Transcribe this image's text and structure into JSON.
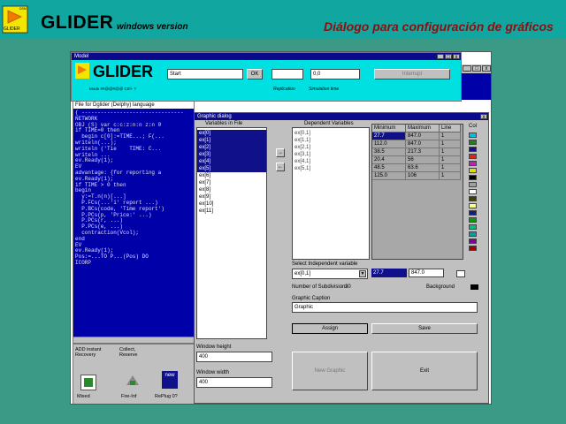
{
  "banner": {
    "title": "GLIDER",
    "version": "windows version",
    "subtitle": "Diálogo para configuración de gráficos",
    "logo_text_top": "DSM",
    "logo_text_bottom": "GLIDER"
  },
  "model_window": {
    "title": "Model",
    "app_name": "GLIDER",
    "input_start": "Start",
    "ok_label": "OK",
    "field_2": "",
    "field_3": "0,0",
    "interrupt_label": "Interrupt",
    "replication_label": "Replication",
    "simulation_time_label": "Simulation time",
    "small_text": "Mode ##@@#@@ Ctrl+ ?"
  },
  "code_window": {
    "header": "File for Dglider (Delphy) language",
    "lines": [
      "{ --------------------------------",
      "",
      "NETWORK",
      "",
      "OBJ (S) var c:c:z:n:n z:n 0",
      "if TIME=0 then",
      "  begin c[0]:=TIME...; F(...",
      "writeln(...);",
      "writeln ('Tie    TIME: C...",
      "writeln ...",
      "ev.Ready(1);",
      "",
      "EV",
      "advantage: {for reporting a",
      "",
      "ev.Ready(1);",
      "",
      "if TIME > 0 then",
      "begin",
      "  y:=T.n(n)[...]",
      "  P.FCs(...'i' report ...)",
      "  P.BCs(code, 'Time report')",
      "  P.PCs(p, 'Price:' ...)",
      "  P.PCs(r, ...)",
      "  P.PCs(e, ...)",
      "  contraction(Vcol);",
      "end",
      "",
      "EV",
      "ev.Ready(1);",
      "Pos:=...TO P...(Pos) DO",
      "ICORP"
    ]
  },
  "bottom_panel": {
    "item1": "ADD instant Recovery",
    "item2": "Collect, Reserve",
    "icon1_label": "Mixed",
    "icon2_label": "Fire-Inf",
    "icon3_label": "RePlug 0?",
    "icon3_badge": "new"
  },
  "graphic_dialog": {
    "title": "Graphic dialog",
    "variables_label": "Variables in File",
    "variables": [
      "ex[0]",
      "ex[1]",
      "ex[2]",
      "ex[3]",
      "ex[4]",
      "ex[5]",
      "ex[6]",
      "ex[7]",
      "ex[8]",
      "ex[9]",
      "ex[10]",
      "ex[11]"
    ],
    "variables_selected_count": 6,
    "arrow_right": "→",
    "arrow_mid": "←",
    "dependent_label": "Dependent Variables",
    "dependent": [
      "ex[0,1]",
      "ex[1,1]",
      "ex[2,1]",
      "ex[3,1]",
      "ex[4,1]",
      "ex[5,1]"
    ],
    "table_headers": [
      "Minimum",
      "Maximum",
      "Line"
    ],
    "table_rows": [
      [
        "27.7",
        "847.0",
        "1"
      ],
      [
        "112.0",
        "847.0",
        "1"
      ],
      [
        "38.5",
        "217.3",
        "1"
      ],
      [
        "20.4",
        "56",
        "1"
      ],
      [
        "48.5",
        "63.6",
        "1"
      ],
      [
        "125.0",
        "106",
        "1"
      ]
    ],
    "table_selected_row": 0,
    "colors_label": "Col",
    "swatch_colors": [
      "#00c0e0",
      "#208020",
      "#101090",
      "#e02020",
      "#c020c0",
      "#e0e000",
      "#000000",
      "#a0a0a0",
      "#ffffff",
      "#404000",
      "#ffff80",
      "#102080",
      "#00a000",
      "#00c080",
      "#00a0a0",
      "#8000a0",
      "#a00000"
    ],
    "independent_label": "Select Independent variable",
    "independent_value": "ex[0,1]",
    "independent_min": "27.7",
    "independent_max": "847.0",
    "number_of_subdivisions_label": "Number of Subdivisions",
    "subdivisions_value": "20",
    "background_label": "Background",
    "caption_label": "Graphic Caption",
    "caption_value": "Graphic",
    "assign_button": "Assign",
    "save_button": "Save",
    "window_height_label": "Window height",
    "window_height_value": "400",
    "window_width_label": "Window width",
    "window_width_value": "400",
    "new_graphic_button": "New Graphic",
    "exit_button": "Exit"
  }
}
